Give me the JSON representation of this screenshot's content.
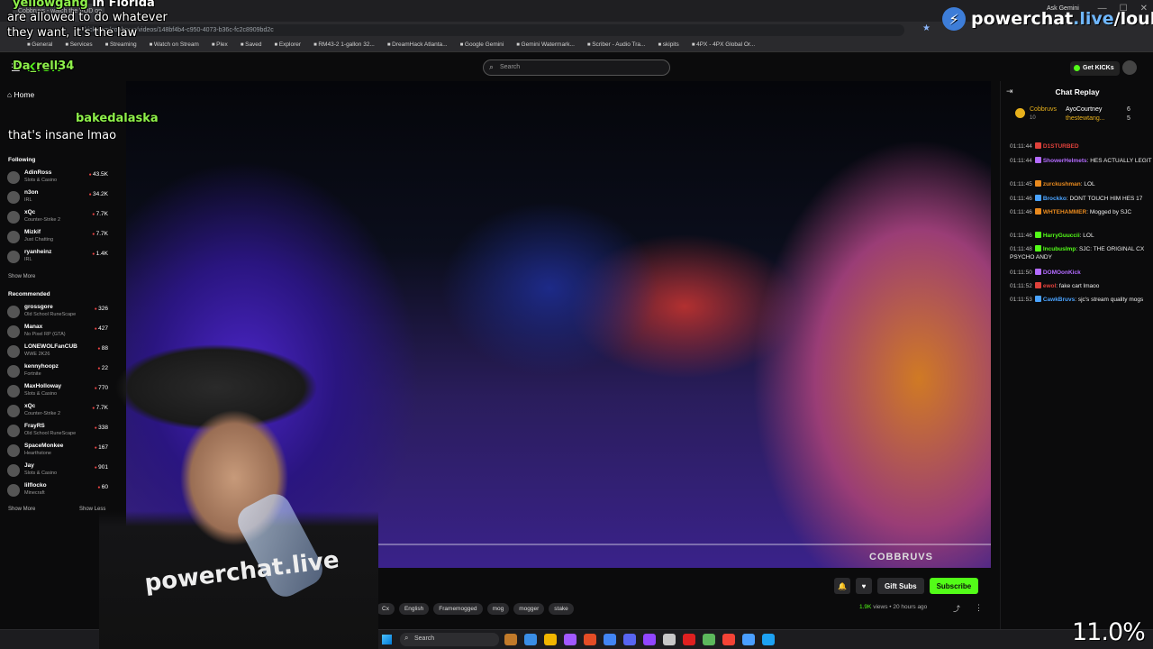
{
  "browser": {
    "tab_title": "Cobbruvs - watch the VOD on",
    "url": "kick.com/cobbruvs/videos/148bf4b4-c950-4073-b36c-fc2c8909bd2c",
    "bookmarks": [
      "General",
      "Services",
      "Streaming",
      "Watch on Stream",
      "Plex",
      "Saved",
      "Explorer",
      "RM43-2 1-gallon 32...",
      "DreamHack Atlanta...",
      "Google Gemini",
      "Gemini Watermark...",
      "Scriber - Audio Tra...",
      "skipits",
      "4PX - 4PX Global Or..."
    ],
    "ask_label": "Ask Gemini"
  },
  "overlay": {
    "brand_prefix": "powerchat",
    "brand_live": ".live",
    "brand_suffix": "/loulz",
    "user1": "yellowgang",
    "user1_tail": "in Florida",
    "line1": "are allowed to do whatever",
    "line2": "they want, it's the law",
    "user2": "Da_rell34",
    "user3": "bakedalaska",
    "line3": "that's insane lmao",
    "cpu": "11.0%"
  },
  "header": {
    "logo": "KICK",
    "search_placeholder": "Search",
    "get_kicks": "Get KICKs"
  },
  "sidebar": {
    "home": "Home",
    "following_title": "Following",
    "following": [
      {
        "name": "AdinRoss",
        "category": "Slots & Casino",
        "viewers": "43.5K"
      },
      {
        "name": "n3on",
        "category": "IRL",
        "viewers": "34.2K"
      },
      {
        "name": "xQc",
        "category": "Counter-Strike 2",
        "viewers": "7.7K"
      },
      {
        "name": "Mizkif",
        "category": "Just Chatting",
        "viewers": "7.7K"
      },
      {
        "name": "ryanheinz",
        "category": "IRL",
        "viewers": "1.4K"
      }
    ],
    "show_more": "Show More",
    "recommended_title": "Recommended",
    "recommended": [
      {
        "name": "grossgore",
        "category": "Old School RuneScape",
        "viewers": "326"
      },
      {
        "name": "Manax",
        "category": "No Pixel RP (GTA)",
        "viewers": "427"
      },
      {
        "name": "LONEWOLFanCUB",
        "category": "WWE 2K26",
        "viewers": "88"
      },
      {
        "name": "kennyhoopz",
        "category": "Fortnite",
        "viewers": "22"
      },
      {
        "name": "MaxHolloway",
        "category": "Slots & Casino",
        "viewers": "770"
      },
      {
        "name": "xQc",
        "category": "Counter-Strike 2",
        "viewers": "7.7K"
      },
      {
        "name": "FrayRS",
        "category": "Old School RuneScape",
        "viewers": "338"
      },
      {
        "name": "SpaceMonkee",
        "category": "Hearthstone",
        "viewers": "167"
      },
      {
        "name": "Jay",
        "category": "Slots & Casino",
        "viewers": "901"
      },
      {
        "name": "lilflocko",
        "category": "Minecraft",
        "viewers": "60"
      }
    ],
    "show_more_2": "Show More",
    "show_less": "Show Less"
  },
  "video": {
    "progress": 0.245,
    "watermark": "COBBRUVS",
    "shirt_text": "powerchat.live"
  },
  "actions": {
    "gift_subs": "Gift Subs",
    "subscribe": "Subscribe"
  },
  "tags": [
    "Cx",
    "English",
    "Framemogged",
    "mog",
    "mogger",
    "stake"
  ],
  "meta": {
    "views_count": "1.9K",
    "views_label": "views",
    "age": "20 hours ago"
  },
  "chat": {
    "title": "Chat Replay",
    "gifters": [
      {
        "name": "Cobbruvs",
        "sub": "10"
      },
      {
        "name": "AyoCourtney",
        "count": "6"
      },
      {
        "name": "thestewtang...",
        "count": "5"
      }
    ],
    "messages": [
      {
        "time": "01:11:44",
        "user": "D1STURBED",
        "user_color": "#e0413b",
        "text": ""
      },
      {
        "time": "01:11:44",
        "user": "ShowerHelmets",
        "user_color": "#b36bff",
        "text": "HES ACTUALLY LEGIT"
      },
      {
        "time": "01:11:45",
        "user": "zurckushman",
        "user_color": "#e98a1e",
        "text": "LOL"
      },
      {
        "time": "01:11:46",
        "user": "Brockko",
        "user_color": "#4aa3ff",
        "text": "DONT TOUCH HIM HES 17"
      },
      {
        "time": "01:11:46",
        "user": "WHTEHAMMER",
        "user_color": "#e98a1e",
        "text": "Mogged by SJC"
      },
      {
        "time": "01:11:46",
        "user": "HarryGuuccii",
        "user_color": "#53fc18",
        "text": "LOL"
      },
      {
        "time": "01:11:48",
        "user": "IncubusImp",
        "user_color": "#53fc18",
        "text": "SJC: THE ORIGINAL CX PSYCHO ANDY"
      },
      {
        "time": "01:11:50",
        "user": "DOMOonKick",
        "user_color": "#b36bff",
        "text": ""
      },
      {
        "time": "01:11:52",
        "user": "ewol",
        "user_color": "#e0413b",
        "text": "fake cart lmaoo"
      },
      {
        "time": "01:11:53",
        "user": "CawkBruvs",
        "user_color": "#4aa3ff",
        "text": "sjc's stream quality mogs"
      }
    ]
  },
  "taskbar": {
    "search": "Search",
    "app_colors": [
      "#c17a2a",
      "#3a8ee6",
      "#f2b600",
      "#a259ff",
      "#e44d26",
      "#4285f4",
      "#5865f2",
      "#9146ff",
      "#c8c8c8",
      "#e02020",
      "#5cb85c",
      "#f44336",
      "#4a9fff",
      "#1da1f2"
    ]
  },
  "colors": {
    "kick_green": "#53fc18",
    "background": "#0b0b0c"
  }
}
